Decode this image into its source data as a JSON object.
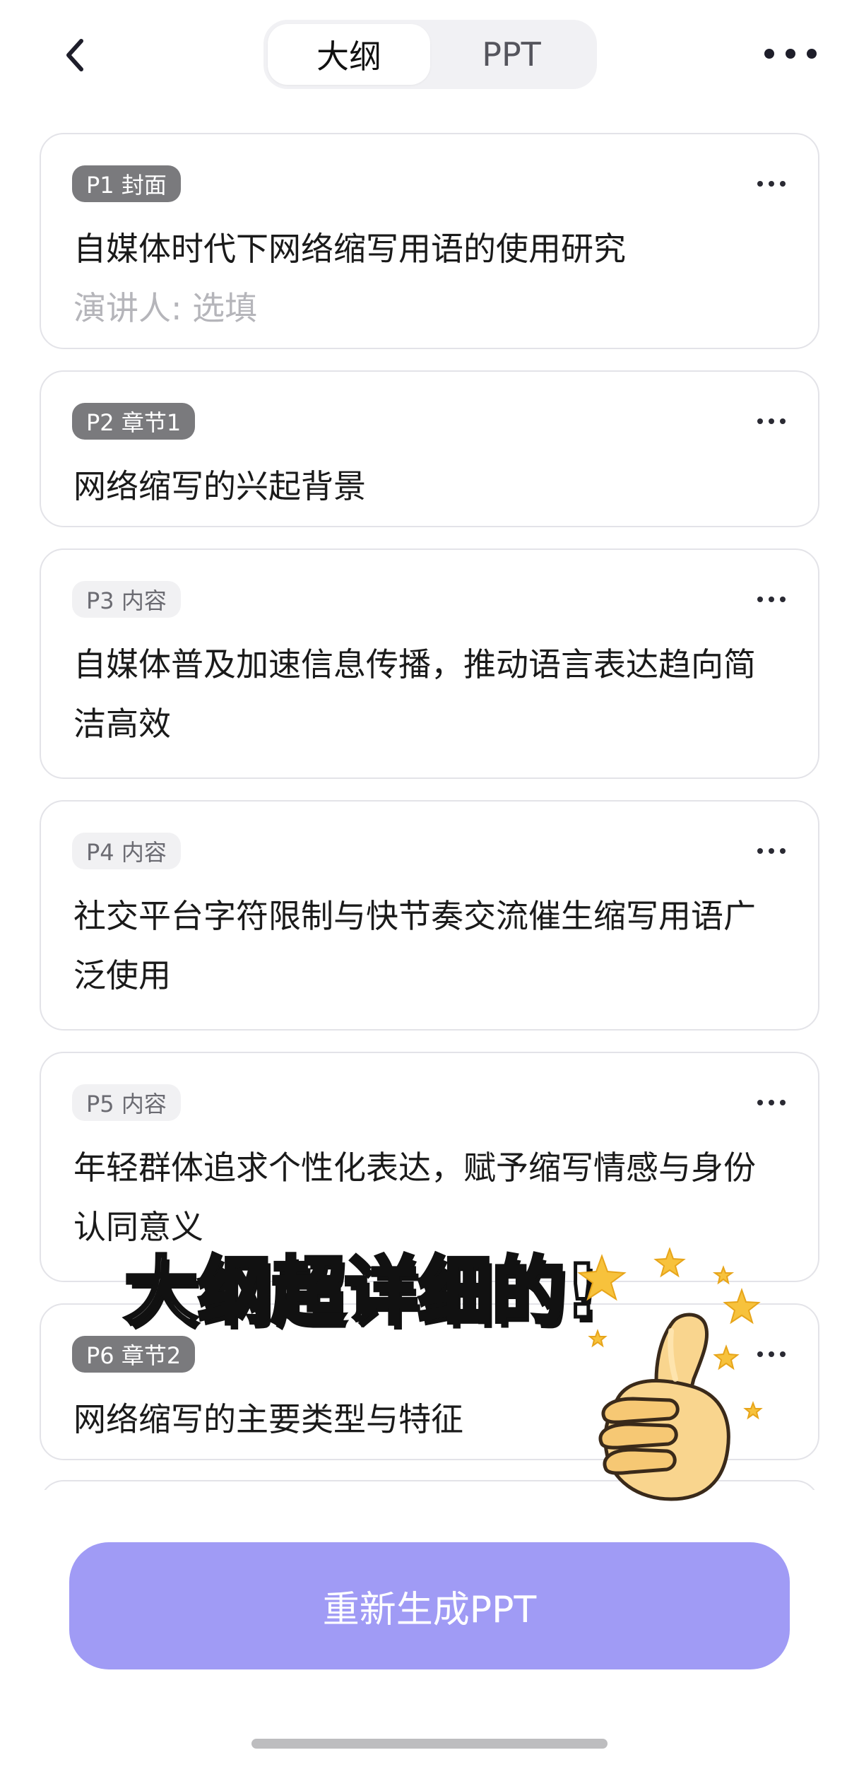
{
  "header": {
    "back_icon": "chevron-left-icon",
    "tabs": [
      {
        "label": "大纲",
        "active": true
      },
      {
        "label": "PPT",
        "active": false
      }
    ],
    "more_icon": "more-horizontal-icon"
  },
  "outline": {
    "cards": [
      {
        "badge": "P1 封面",
        "badge_style": "dark",
        "title": "自媒体时代下网络缩写用语的使用研究",
        "subtitle": "演讲人: 选填"
      },
      {
        "badge": "P2 章节1",
        "badge_style": "dark",
        "title": "网络缩写的兴起背景"
      },
      {
        "badge": "P3 内容",
        "badge_style": "light",
        "title": "自媒体普及加速信息传播，推动语言表达趋向简洁高效"
      },
      {
        "badge": "P4 内容",
        "badge_style": "light",
        "title": "社交平台字符限制与快节奏交流催生缩写用语广泛使用"
      },
      {
        "badge": "P5 内容",
        "badge_style": "light",
        "title": "年轻群体追求个性化表达，赋予缩写情感与身份认同意义"
      },
      {
        "badge": "P6 章节2",
        "badge_style": "dark",
        "title": "网络缩写的主要类型与特征"
      }
    ]
  },
  "overlay": {
    "caption": "大纲超详细的!",
    "sticker_icon": "thumbs-up-icon"
  },
  "footer": {
    "regenerate_label": "重新生成PPT"
  },
  "colors": {
    "accent": "#a09bf5",
    "badge_dark": "#7a7a7d",
    "badge_light": "#f1f1f3",
    "placeholder": "#b5b5ba"
  }
}
